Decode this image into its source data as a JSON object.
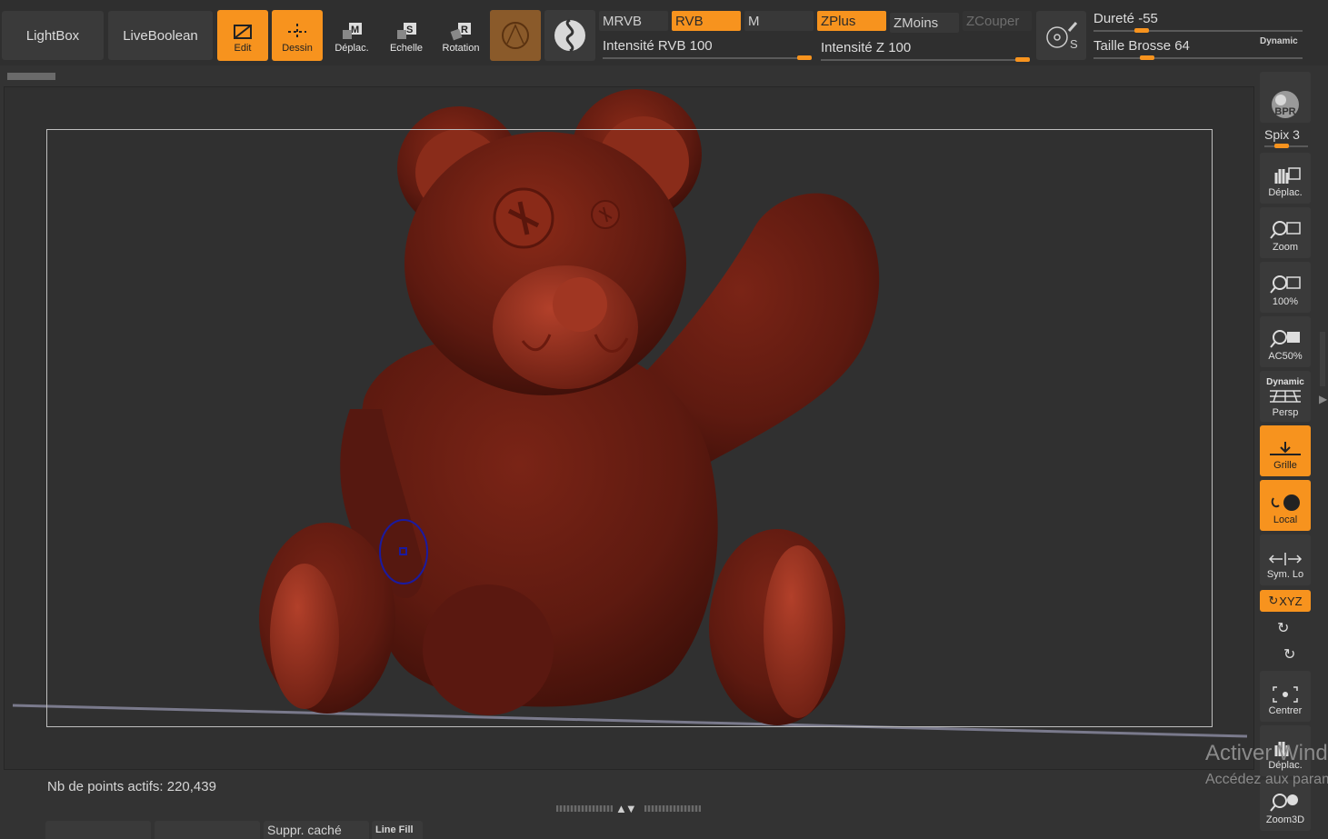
{
  "toolbar": {
    "lightbox": "LightBox",
    "liveboolean": "LiveBoolean",
    "edit": "Edit",
    "draw": "Dessin",
    "move": "Déplac.",
    "scale": "Echelle",
    "rotate": "Rotation",
    "mrgb": "MRVB",
    "rgb": "RVB",
    "m": "M",
    "rgb_intensity_label": "Intensité RVB",
    "rgb_intensity_value": "100",
    "zadd": "ZPlus",
    "zsub": "ZMoins",
    "zcut": "ZCouper",
    "z_intensity_label": "Intensité Z",
    "z_intensity_value": "100",
    "hardness_label": "Dureté",
    "hardness_value": "-55",
    "brush_size_label": "Taille Brosse",
    "brush_size_value": "64",
    "dynamic": "Dynamic"
  },
  "right_shelf": {
    "bpr": "BPR",
    "spix_label": "Spix",
    "spix_value": "3",
    "move": "Déplac.",
    "zoom": "Zoom",
    "actual": "100%",
    "ac50": "AC50%",
    "persp_dynamic": "Dynamic",
    "persp": "Persp",
    "floor": "Grille",
    "local": "Local",
    "sym": "Sym. Lo",
    "xyz": "XYZ",
    "center": "Centrer",
    "move2": "Déplac.",
    "zoom3d": "Zoom3D"
  },
  "status": {
    "active_points": "Nb de points actifs: 220,439"
  },
  "bottom": {
    "delete_hidden": "Suppr. caché",
    "line_fill": "Line Fill"
  },
  "watermark": {
    "line1": "Activer Windows",
    "line2": "Accédez aux paramètres"
  },
  "colors": {
    "accent": "#f7931e",
    "model": "#6e1d12",
    "background": "#333333"
  }
}
